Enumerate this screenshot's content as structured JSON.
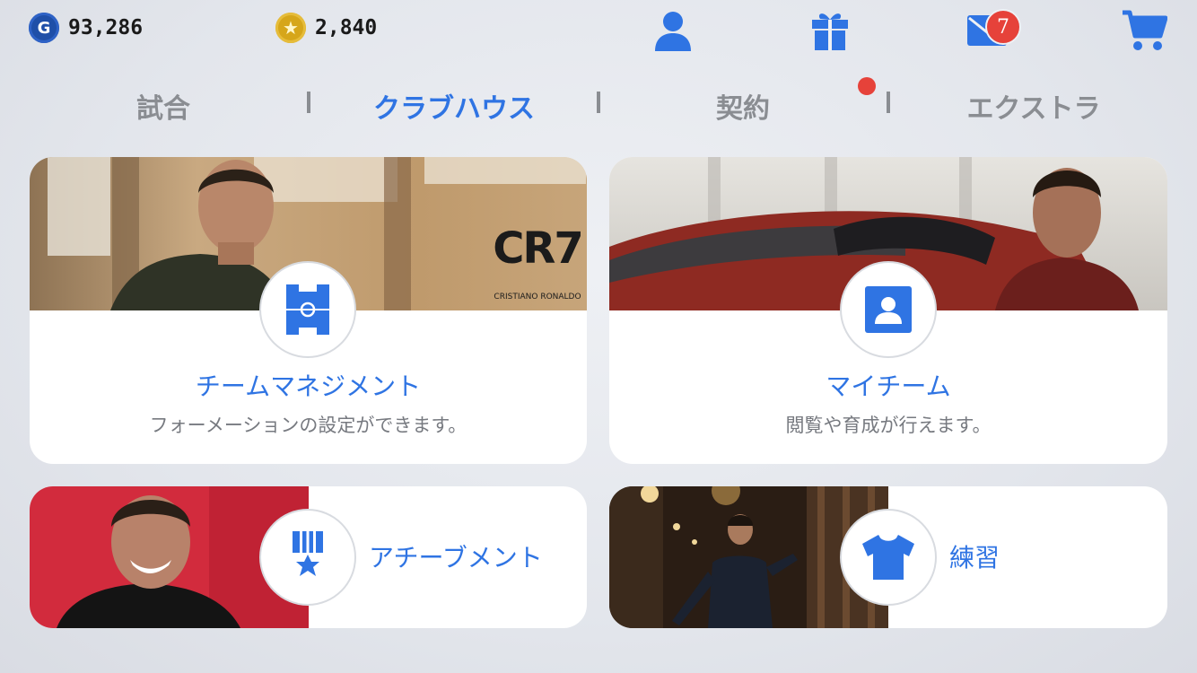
{
  "currency": {
    "gp": {
      "icon": "gp-coin-icon",
      "letter": "G",
      "value": "93,286"
    },
    "coins": {
      "icon": "star-coin-icon",
      "value": "2,840"
    }
  },
  "header_icons": {
    "profile": "user-icon",
    "gift": "gift-icon",
    "mail": {
      "icon": "mail-icon",
      "badge": "7"
    },
    "shop": "cart-icon"
  },
  "tabs": [
    {
      "label": "試合",
      "active": false
    },
    {
      "label": "クラブハウス",
      "active": true
    },
    {
      "label": "契約",
      "active": false,
      "notification": true
    },
    {
      "label": "エクストラ",
      "active": false
    }
  ],
  "cards": {
    "team_management": {
      "title": "チームマネジメント",
      "description": "フォーメーションの設定ができます。",
      "icon": "formation-pitch-icon",
      "photo_logo": "CR7",
      "photo_logo_sub": "CRISTIANO RONALDO"
    },
    "my_team": {
      "title": "マイチーム",
      "description": "閲覧や育成が行えます。",
      "icon": "player-profile-icon"
    },
    "achievements": {
      "title": "アチーブメント",
      "icon": "medal-icon"
    },
    "training": {
      "title": "練習",
      "icon": "jersey-icon"
    }
  },
  "colors": {
    "accent": "#2f74e3",
    "inactive_tab": "#8a8d92",
    "notification": "#e6423a"
  }
}
